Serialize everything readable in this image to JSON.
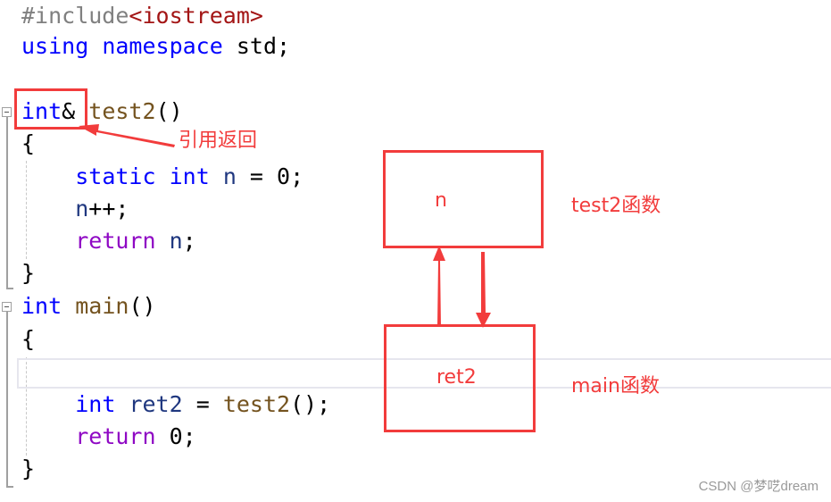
{
  "code": {
    "lines": [
      [
        {
          "t": "#include",
          "c": "pre"
        },
        {
          "t": "<iostream>",
          "c": "inc"
        }
      ],
      [
        {
          "t": "using",
          "c": "kw"
        },
        {
          "t": " ",
          "c": "plain"
        },
        {
          "t": "namespace",
          "c": "kw"
        },
        {
          "t": " std;",
          "c": "plain"
        }
      ],
      [],
      [
        {
          "t": "int",
          "c": "kw"
        },
        {
          "t": "& ",
          "c": "plain"
        },
        {
          "t": "test2",
          "c": "fn"
        },
        {
          "t": "()",
          "c": "plain"
        }
      ],
      [
        {
          "t": "{",
          "c": "plain"
        }
      ],
      [
        {
          "t": "    ",
          "c": "plain"
        },
        {
          "t": "static",
          "c": "kw"
        },
        {
          "t": " ",
          "c": "plain"
        },
        {
          "t": "int",
          "c": "kw"
        },
        {
          "t": " ",
          "c": "plain"
        },
        {
          "t": "n",
          "c": "var"
        },
        {
          "t": " = 0;",
          "c": "plain"
        }
      ],
      [
        {
          "t": "    ",
          "c": "plain"
        },
        {
          "t": "n",
          "c": "var"
        },
        {
          "t": "++;",
          "c": "plain"
        }
      ],
      [
        {
          "t": "    ",
          "c": "plain"
        },
        {
          "t": "return",
          "c": "ctl"
        },
        {
          "t": " ",
          "c": "plain"
        },
        {
          "t": "n",
          "c": "var"
        },
        {
          "t": ";",
          "c": "plain"
        }
      ],
      [
        {
          "t": "}",
          "c": "plain"
        }
      ],
      [
        {
          "t": "int",
          "c": "kw"
        },
        {
          "t": " ",
          "c": "plain"
        },
        {
          "t": "main",
          "c": "fn"
        },
        {
          "t": "()",
          "c": "plain"
        }
      ],
      [
        {
          "t": "{",
          "c": "plain"
        }
      ],
      [],
      [
        {
          "t": "    ",
          "c": "plain"
        },
        {
          "t": "int",
          "c": "kw"
        },
        {
          "t": " ",
          "c": "plain"
        },
        {
          "t": "ret2",
          "c": "var"
        },
        {
          "t": " = ",
          "c": "plain"
        },
        {
          "t": "test2",
          "c": "fn"
        },
        {
          "t": "();",
          "c": "plain"
        }
      ],
      [
        {
          "t": "    ",
          "c": "plain"
        },
        {
          "t": "return",
          "c": "ctl"
        },
        {
          "t": " 0;",
          "c": "plain"
        }
      ],
      [
        {
          "t": "}",
          "c": "plain"
        }
      ]
    ]
  },
  "annotations": {
    "reference_return_label": "引用返回",
    "box_n_label": "n",
    "box_ret2_label": "ret2",
    "test2_function_label": "test2函数",
    "main_function_label": "main函数"
  },
  "colors": {
    "annotation_red": "#f23c3c"
  },
  "watermark": "CSDN @梦呓dream"
}
